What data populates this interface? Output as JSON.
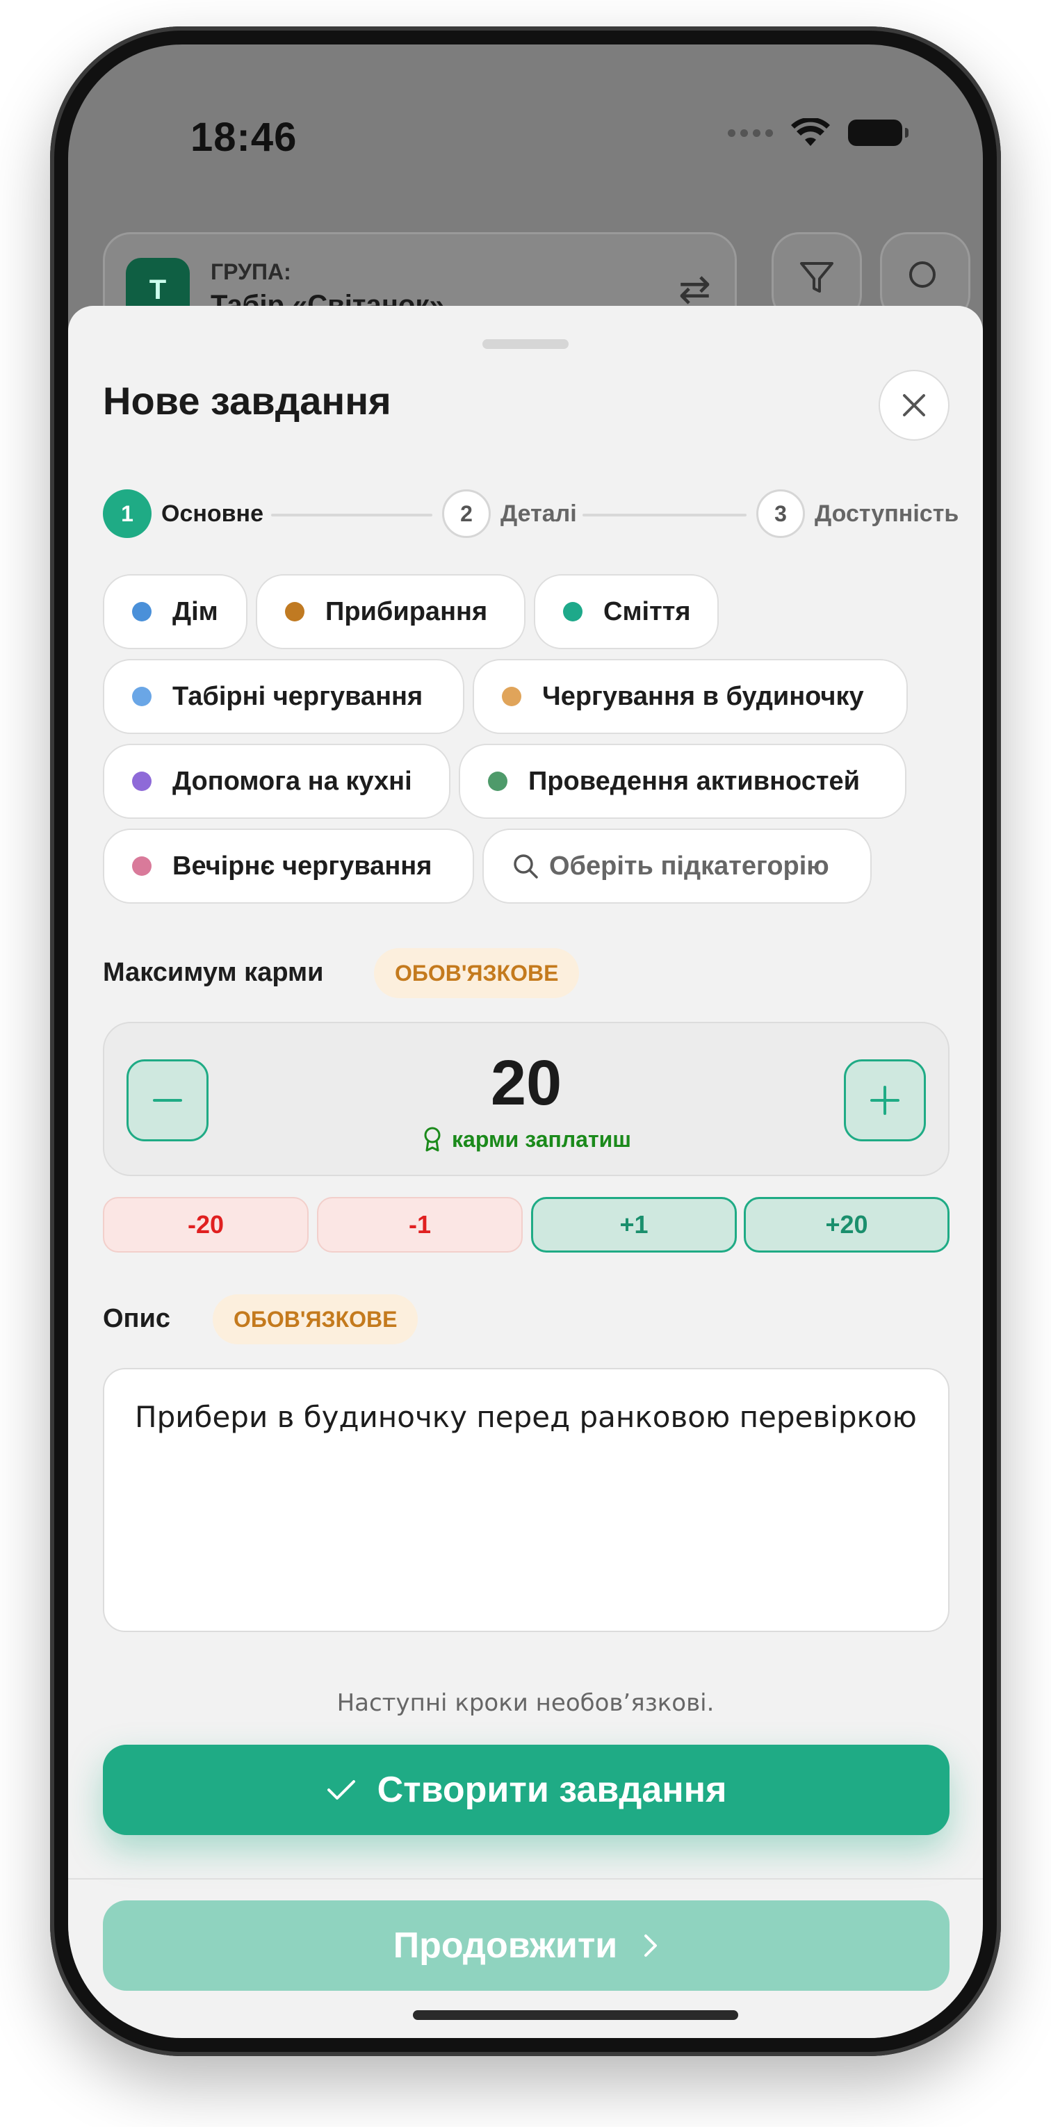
{
  "status_bar": {
    "time": "18:46"
  },
  "background": {
    "group_label": "ГРУПА:",
    "group_name": "Табір «Світанок»",
    "avatar_letter": "Т"
  },
  "sheet": {
    "title": "Нове завдання",
    "steps": [
      {
        "number": "1",
        "label": "Основне",
        "active": true
      },
      {
        "number": "2",
        "label": "Деталі",
        "active": false
      },
      {
        "number": "3",
        "label": "Доступність",
        "active": false
      }
    ],
    "categories": [
      {
        "label": "Дім",
        "color": "#4a90d9"
      },
      {
        "label": "Прибирання",
        "color": "#c07a22"
      },
      {
        "label": "Сміття",
        "color": "#1ea98a"
      },
      {
        "label": "Табірні чергування",
        "color": "#6aa6e6"
      },
      {
        "label": "Чергування в будиночку",
        "color": "#e0a45a"
      },
      {
        "label": "Допомога на кухні",
        "color": "#8e6ad8"
      },
      {
        "label": "Проведення активностей",
        "color": "#4e9a6a"
      },
      {
        "label": "Вечірнє чергування",
        "color": "#d97a9a"
      }
    ],
    "subcategory_placeholder": "Оберіть підкатегорію",
    "karma": {
      "label": "Максимум карми",
      "badge": "ОБОВ'ЯЗКОВЕ",
      "value": "20",
      "caption": "карми заплатиш",
      "quick": [
        "-20",
        "-1",
        "+1",
        "+20"
      ]
    },
    "description": {
      "label": "Опис",
      "badge": "ОБОВ'ЯЗКОВЕ",
      "value": "Прибери в будиночку перед ранковою перевіркою"
    },
    "hint": "Наступні кроки необов’язкові.",
    "create_label": "Створити завдання",
    "continue_label": "Продовжити"
  },
  "colors": {
    "accent": "#1fab85",
    "accent_light": "#8fd3bf",
    "required": "#c47a1d",
    "negative": "#e02020"
  }
}
